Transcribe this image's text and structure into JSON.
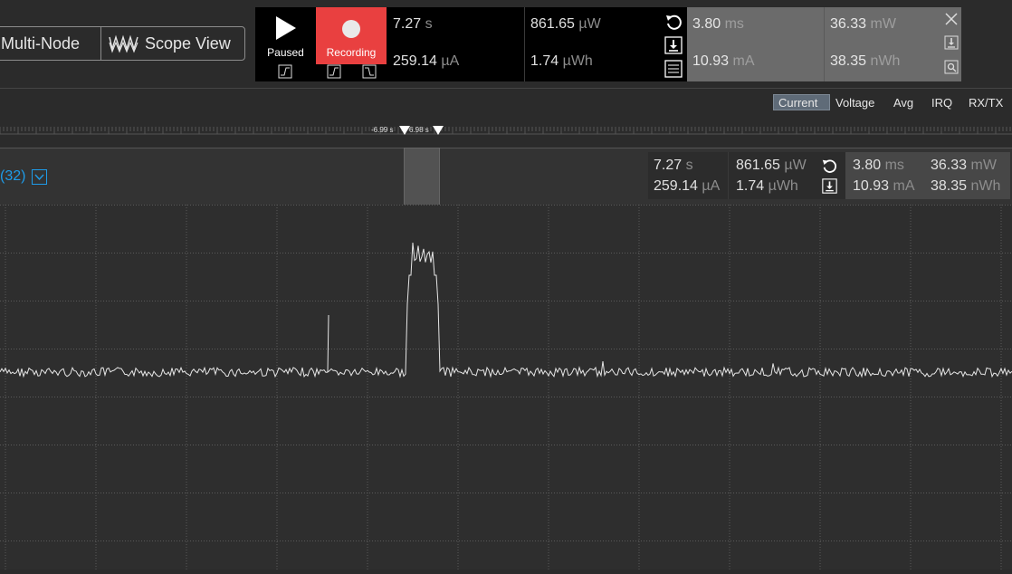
{
  "toolbar": {
    "multi_node_label": "Multi-Node",
    "scope_view_label": "Scope View",
    "paused_label": "Paused",
    "recording_label": "Recording"
  },
  "measurements_main": {
    "time": {
      "value": "7.27",
      "unit": "s"
    },
    "current": {
      "value": "259.14",
      "unit": "µA"
    },
    "power": {
      "value": "861.65",
      "unit": "µW"
    },
    "energy": {
      "value": "1.74",
      "unit": "µWh"
    }
  },
  "measurements_selection": {
    "time": {
      "value": "3.80",
      "unit": "ms"
    },
    "current": {
      "value": "10.93",
      "unit": "mA"
    },
    "power": {
      "value": "36.33",
      "unit": "mW"
    },
    "energy": {
      "value": "38.35",
      "unit": "nWh"
    }
  },
  "tabs": [
    "Current",
    "Voltage",
    "Avg",
    "IRQ",
    "RX/TX"
  ],
  "active_tab": "Current",
  "timeline": {
    "cursor_left_label": "-6.99 s",
    "cursor_right_label": "6.98 s"
  },
  "channel": {
    "label": "(32)"
  },
  "colors": {
    "recording": "#e94040",
    "channel_accent": "#1e9be8",
    "trace": "#e6e6e6",
    "selection": "#5a5a5a"
  }
}
